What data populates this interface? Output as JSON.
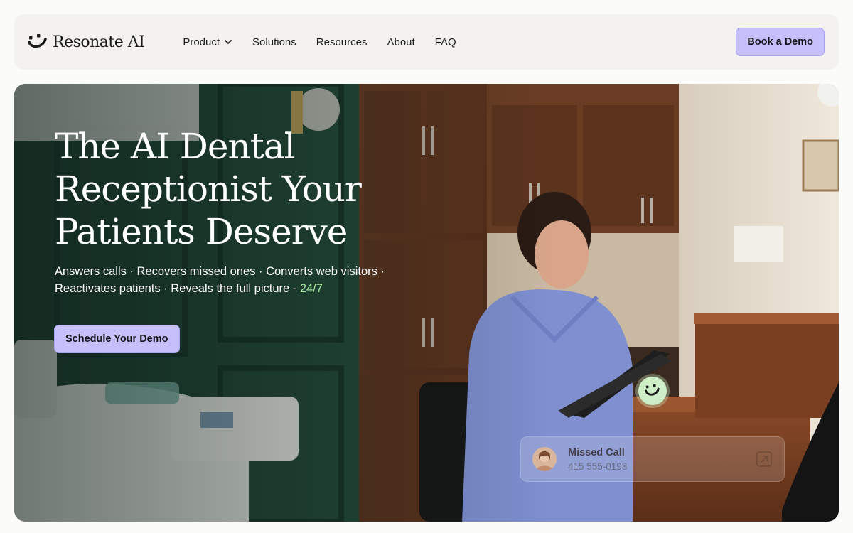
{
  "brand": {
    "name": "Resonate AI",
    "logo_icon": "smile-logo-icon"
  },
  "nav": {
    "items": [
      {
        "label": "Product",
        "has_dropdown": true
      },
      {
        "label": "Solutions"
      },
      {
        "label": "Resources"
      },
      {
        "label": "About"
      },
      {
        "label": "FAQ"
      }
    ],
    "cta_label": "Book a Demo"
  },
  "hero": {
    "title": "The AI Dental Receptionist Your Patients Deserve",
    "subtitle": "Answers calls · Recovers missed ones · Converts web visitors · Reactivates patients · Reveals the full picture - ",
    "subtitle_accent": "24/7",
    "cta_label": "Schedule Your Demo"
  },
  "missed_call_card": {
    "title": "Missed Call",
    "phone": "415 555-0198",
    "icon": "phone-callback-icon"
  },
  "colors": {
    "accent_purple": "#c5c0fb",
    "accent_green": "#a8e6a1",
    "nav_bg": "#f3f2ef"
  }
}
